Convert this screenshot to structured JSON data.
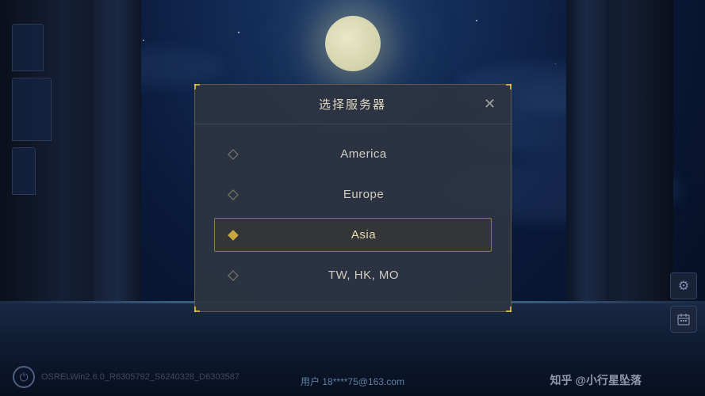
{
  "dialog": {
    "title": "选择服务器",
    "close_label": "✕",
    "servers": [
      {
        "id": "america",
        "name": "America",
        "selected": false
      },
      {
        "id": "europe",
        "name": "Europe",
        "selected": false
      },
      {
        "id": "asia",
        "name": "Asia",
        "selected": true
      },
      {
        "id": "tw-hk-mo",
        "name": "TW, HK, MO",
        "selected": false
      }
    ]
  },
  "bottom": {
    "version": "OSRELWin2.6.0_R6305792_S6240328_D6303587",
    "user_label": "用户",
    "user_email": "18****75@163.com"
  },
  "watermark": {
    "text": "知乎 @小行星坠落"
  },
  "right_icons": [
    {
      "id": "settings",
      "symbol": "⚙"
    },
    {
      "id": "calendar",
      "symbol": "📅"
    }
  ],
  "colors": {
    "accent": "#c8a840",
    "selected_border": "rgba(200,170,80,0.6)",
    "dialog_bg": "rgba(45,52,65,0.95)"
  }
}
